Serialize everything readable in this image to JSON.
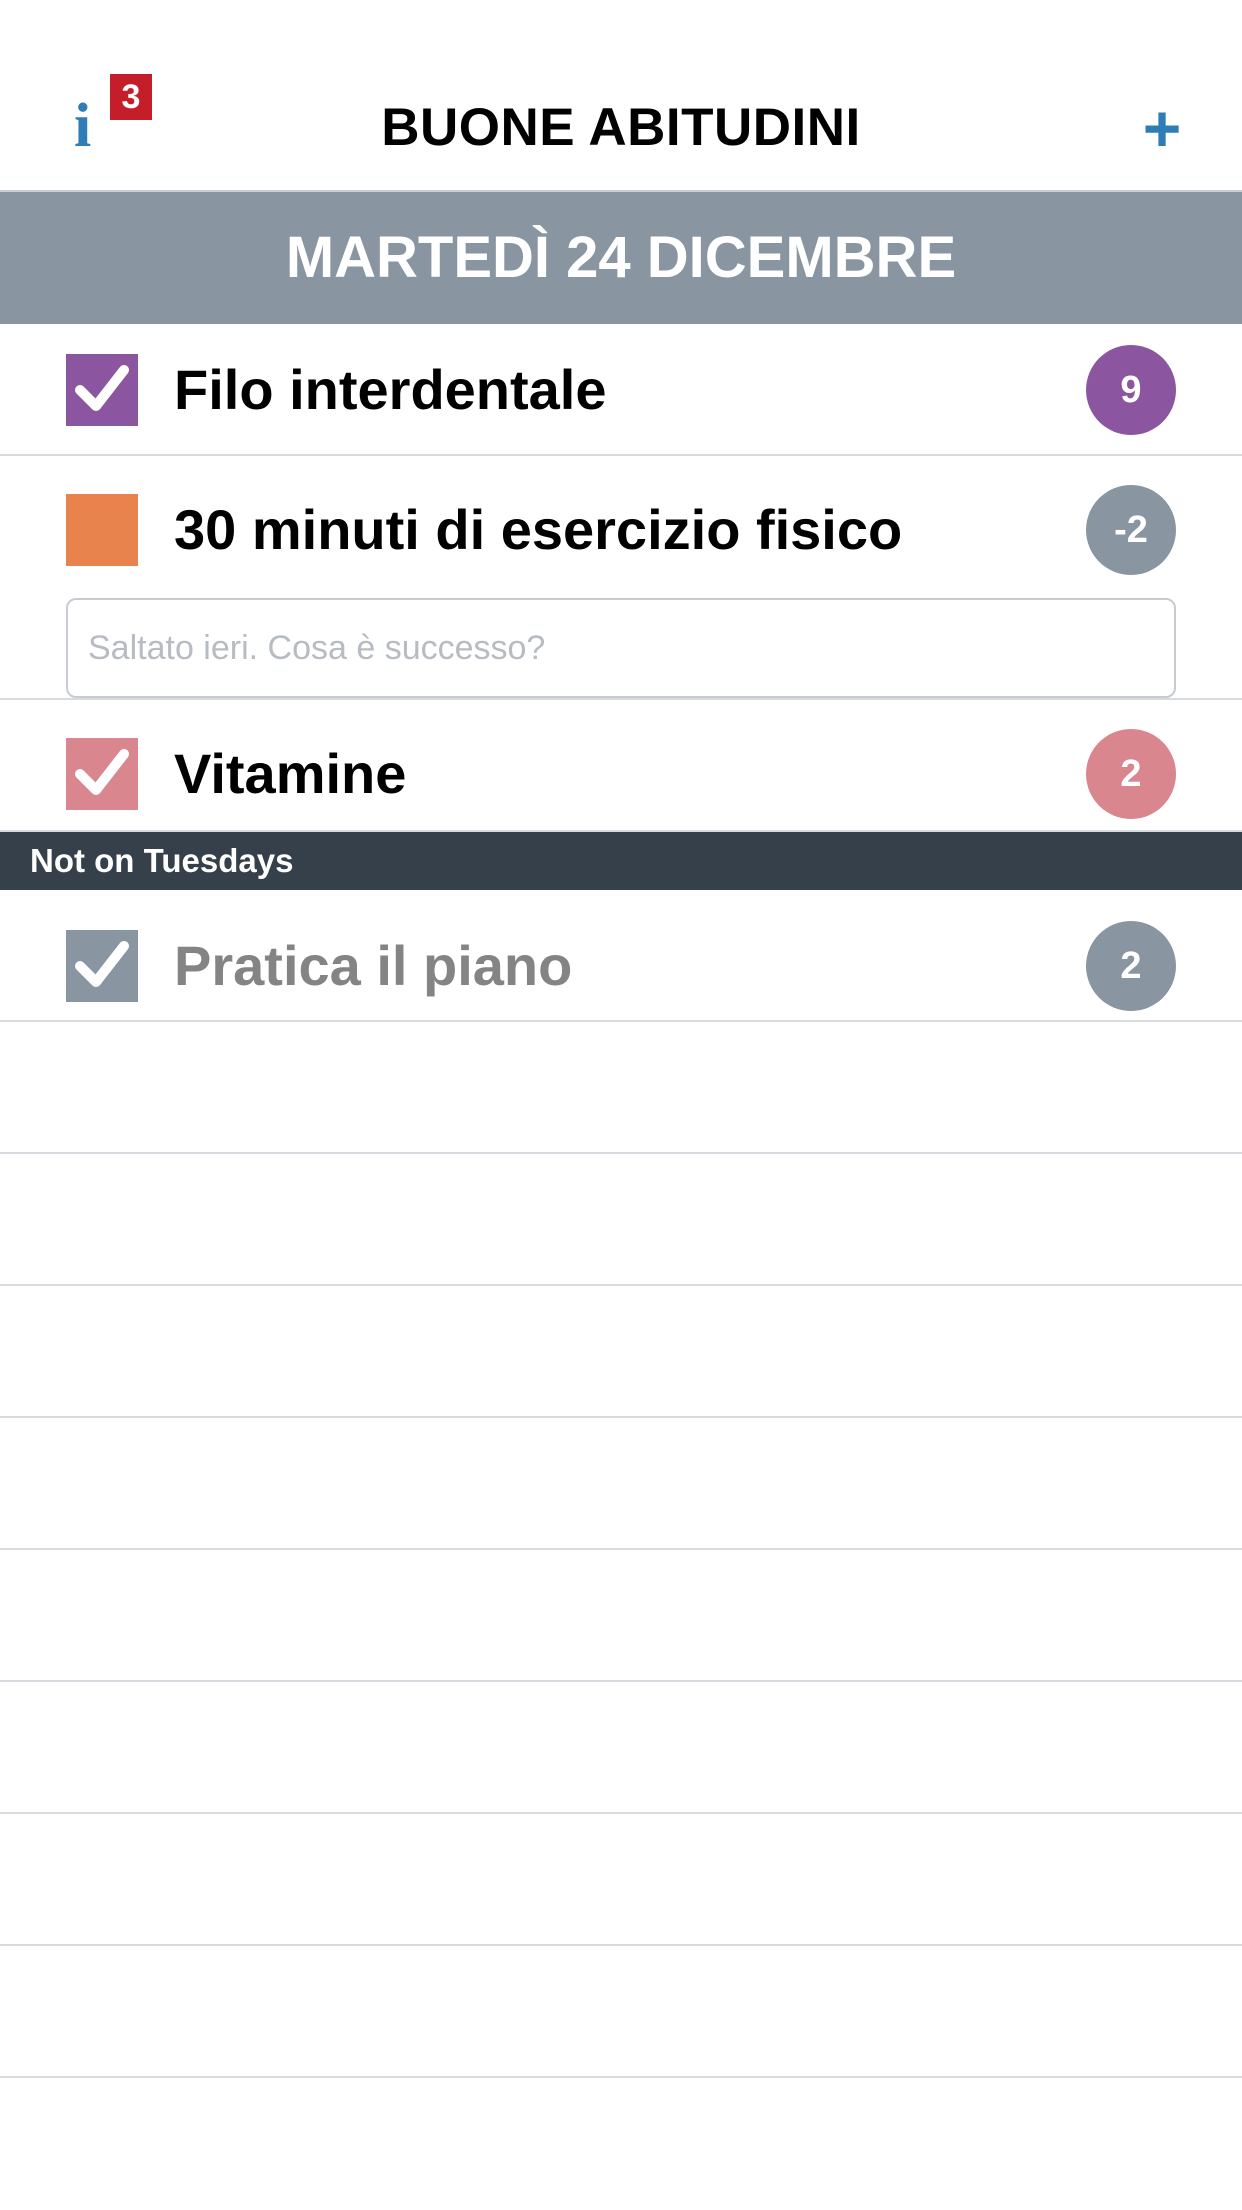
{
  "header": {
    "info_icon": "info-icon",
    "info_glyph": "i",
    "badge_count": "3",
    "title": "BUONE ABITUDINI",
    "add_icon": "plus-icon",
    "add_glyph": "+"
  },
  "date_label": "MARTEDÌ 24 DICEMBRE",
  "habits": [
    {
      "label": "Filo interdentale",
      "checked": true,
      "color": "#8c55a0",
      "count": "9",
      "count_color": "#8c55a0"
    },
    {
      "label": "30 minuti di esercizio fisico",
      "checked": false,
      "color": "#e8834e",
      "count": "-2",
      "count_color": "#8a95a2",
      "note_placeholder": "Saltato ieri. Cosa è successo?"
    },
    {
      "label": "Vitamine",
      "checked": true,
      "color": "#d9868f",
      "count": "2",
      "count_color": "#d9868f"
    }
  ],
  "section": {
    "title": "Not on Tuesdays",
    "habits": [
      {
        "label": "Pratica il piano",
        "checked": true,
        "color": "#8a95a2",
        "count": "2",
        "count_color": "#8a95a2",
        "label_color": "#848484"
      }
    ]
  },
  "colors": {
    "accent": "#2f7db6",
    "badge": "#c41e2b",
    "date_bar": "#8a95a2",
    "section_bar": "#36404b"
  }
}
